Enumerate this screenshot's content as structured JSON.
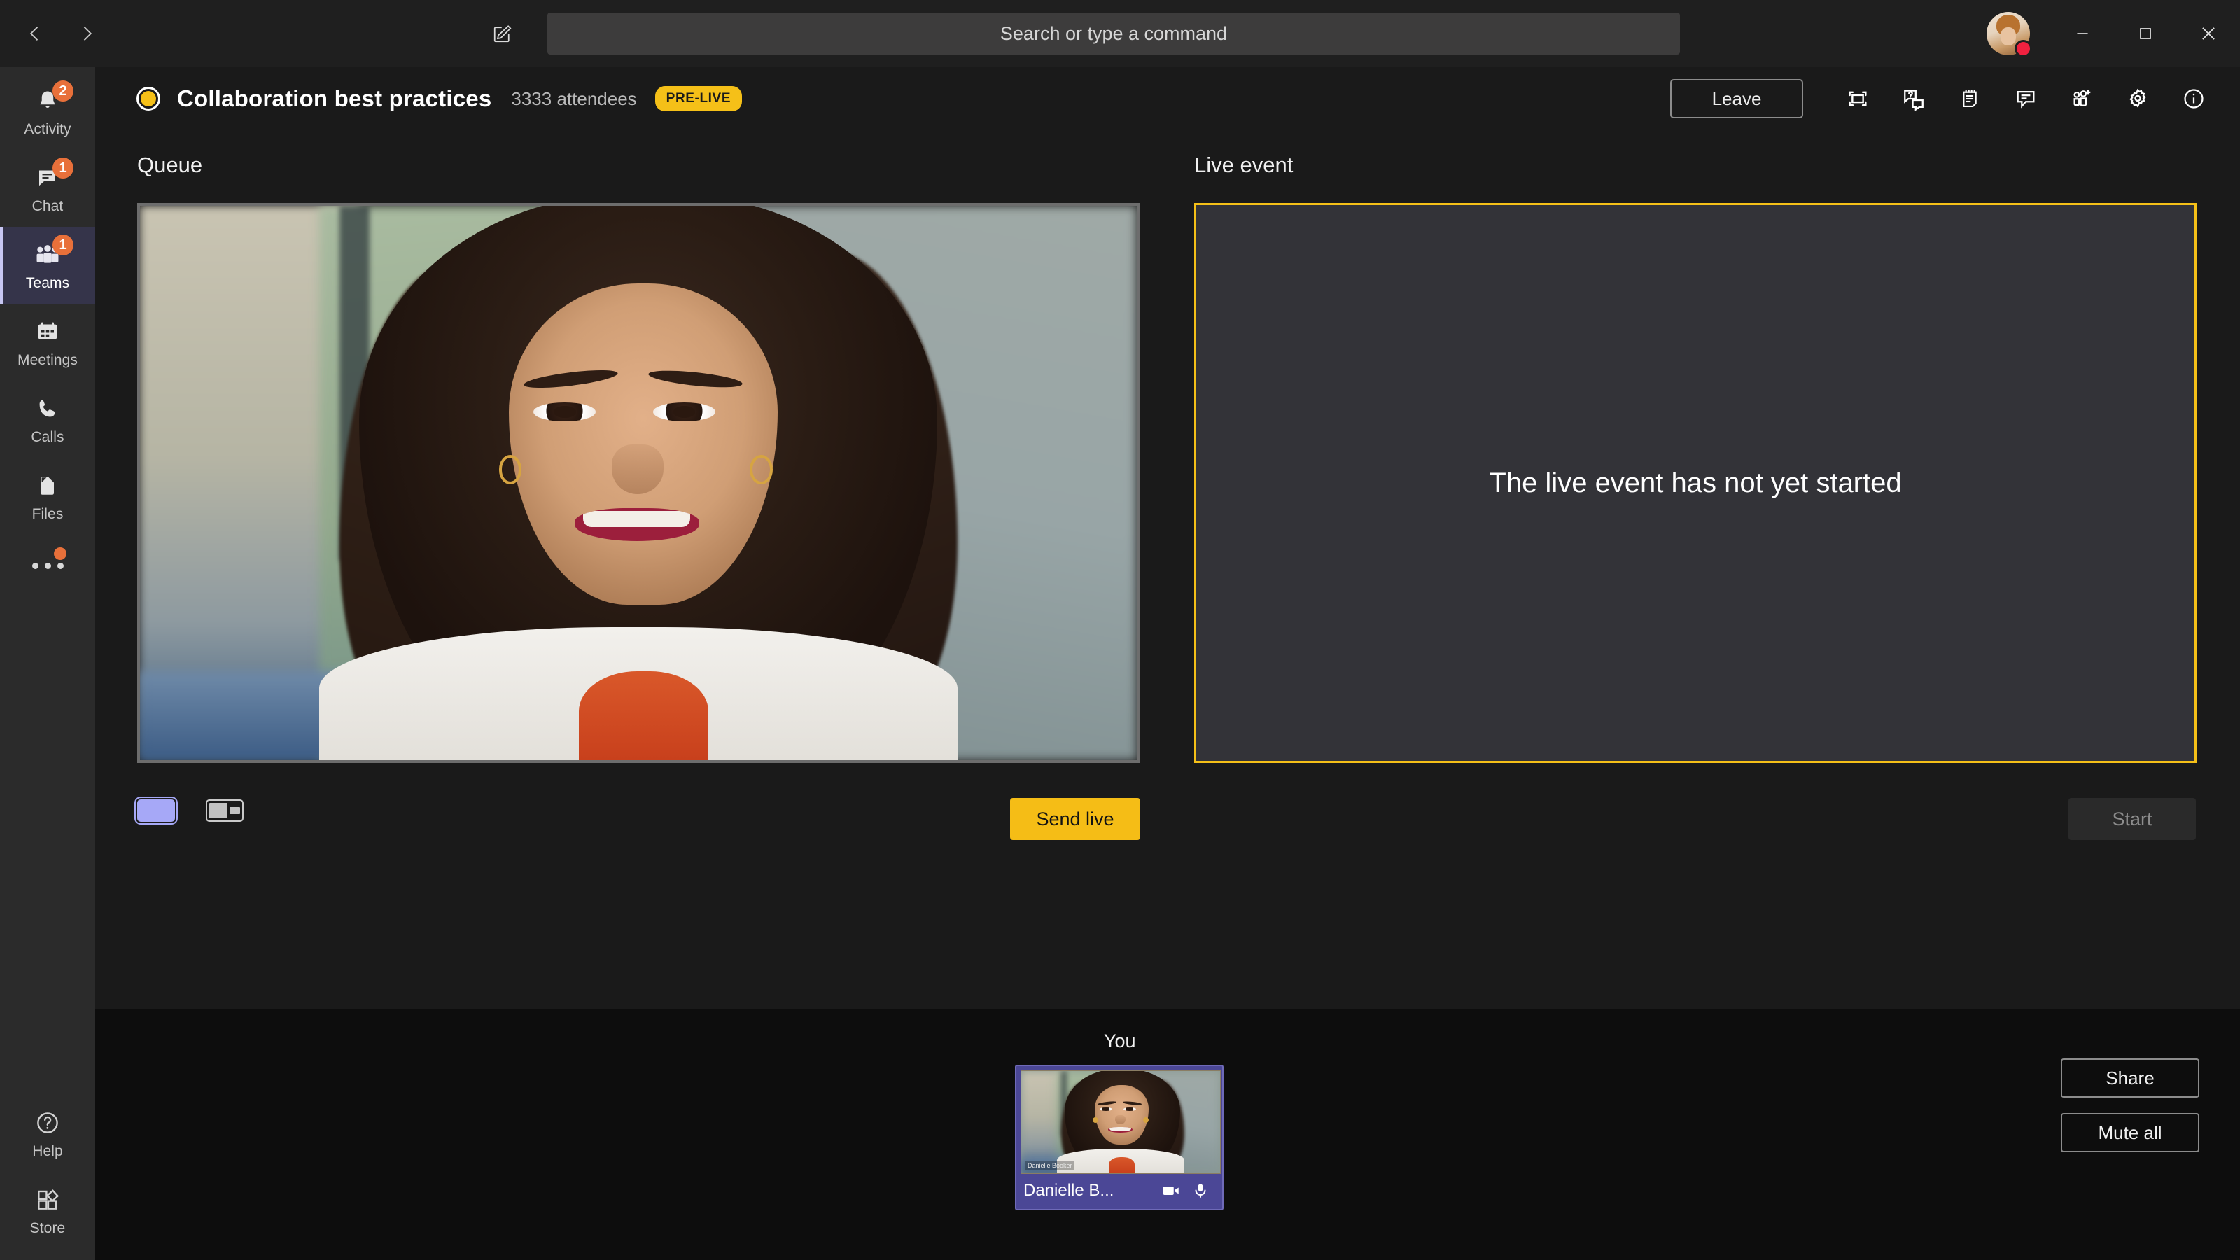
{
  "titlebar": {
    "back_label": "Back",
    "forward_label": "Forward",
    "compose_label": "New chat",
    "search_placeholder": "Search or type a command",
    "search_value": "",
    "minimize_label": "Minimize",
    "maximize_label": "Maximize",
    "close_label": "Close",
    "presence_status": "Busy",
    "presence_color": "#f0213f"
  },
  "sidebar": {
    "items": [
      {
        "label": "Activity",
        "icon": "bell-icon",
        "badge": "2",
        "active": false
      },
      {
        "label": "Chat",
        "icon": "chat-icon",
        "badge": "1",
        "active": false
      },
      {
        "label": "Teams",
        "icon": "teams-icon",
        "badge": "1",
        "active": true
      },
      {
        "label": "Meetings",
        "icon": "calendar-icon",
        "badge": "",
        "active": false
      },
      {
        "label": "Calls",
        "icon": "phone-icon",
        "badge": "",
        "active": false
      },
      {
        "label": "Files",
        "icon": "files-icon",
        "badge": "",
        "active": false
      }
    ],
    "more_label": "More apps",
    "bottom_items": [
      {
        "label": "Help",
        "icon": "help-icon"
      },
      {
        "label": "Store",
        "icon": "store-icon"
      }
    ],
    "badge_color": "#e8703a",
    "active_accent": "#c7c6f2"
  },
  "meeting": {
    "title": "Collaboration best practices",
    "attendees": "3333 attendees",
    "status_badge": "PRE-LIVE",
    "status_color": "#f5c018",
    "recording_indicator": "live-event-dot-icon",
    "leave_label": "Leave",
    "toolbar_icons": [
      {
        "name": "fullscreen-icon",
        "title": "Full screen"
      },
      {
        "name": "qna-icon",
        "title": "Q&A"
      },
      {
        "name": "notes-icon",
        "title": "Meeting notes"
      },
      {
        "name": "chat-icon",
        "title": "Show conversation"
      },
      {
        "name": "add-participant-icon",
        "title": "Add participants"
      },
      {
        "name": "settings-gear-icon",
        "title": "Device settings"
      },
      {
        "name": "info-icon",
        "title": "Event info"
      }
    ]
  },
  "queue": {
    "label": "Queue",
    "layouts": [
      {
        "name": "layout-single",
        "selected": true
      },
      {
        "name": "layout-split",
        "selected": false
      }
    ],
    "send_live_label": "Send live",
    "send_live_color": "#f5bd16"
  },
  "live_event": {
    "label": "Live event",
    "message": "The live event has not yet started",
    "border_color": "#f5c018",
    "start_label": "Start",
    "start_disabled": true
  },
  "bottom": {
    "you_label": "You",
    "self_tile": {
      "name": "Danielle B...",
      "video_caption": "Danielle Booker",
      "camera_icon": "camera-icon",
      "mic_icon": "microphone-icon",
      "tile_color": "#4b4796"
    },
    "share_label": "Share",
    "mute_all_label": "Mute all"
  }
}
